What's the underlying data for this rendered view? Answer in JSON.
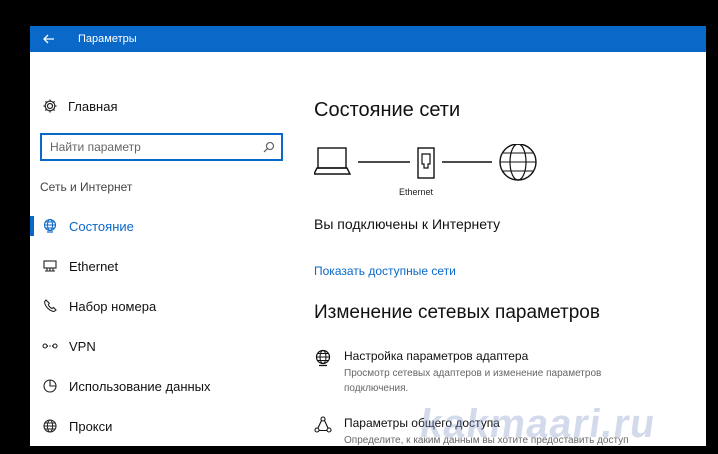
{
  "window": {
    "title": "Параметры"
  },
  "sidebar": {
    "home_label": "Главная",
    "search_placeholder": "Найти параметр",
    "section_label": "Сеть и Интернет",
    "items": [
      {
        "label": "Состояние",
        "icon": "globe-monitor-icon",
        "active": true
      },
      {
        "label": "Ethernet",
        "icon": "ethernet-icon",
        "active": false
      },
      {
        "label": "Набор номера",
        "icon": "phone-icon",
        "active": false
      },
      {
        "label": "VPN",
        "icon": "vpn-icon",
        "active": false
      },
      {
        "label": "Использование данных",
        "icon": "data-usage-icon",
        "active": false
      },
      {
        "label": "Прокси",
        "icon": "globe-icon",
        "active": false
      }
    ]
  },
  "main": {
    "title": "Состояние сети",
    "diagram_label": "Ethernet",
    "connected_text": "Вы подключены к Интернету",
    "show_networks_link": "Показать доступные сети",
    "change_title": "Изменение сетевых параметров",
    "settings": [
      {
        "title": "Настройка параметров адаптера",
        "description": "Просмотр сетевых адаптеров и изменение параметров подключения.",
        "icon": "globe-monitor-icon"
      },
      {
        "title": "Параметры общего доступа",
        "description": "Определите, к каким данным вы хотите предоставить доступ для сетей, с которыми установлено соединение.",
        "icon": "sharing-icon"
      }
    ]
  },
  "watermark": "kakmaari.ru",
  "colors": {
    "accent": "#0a68c9",
    "text": "#111111",
    "muted": "#666666"
  }
}
